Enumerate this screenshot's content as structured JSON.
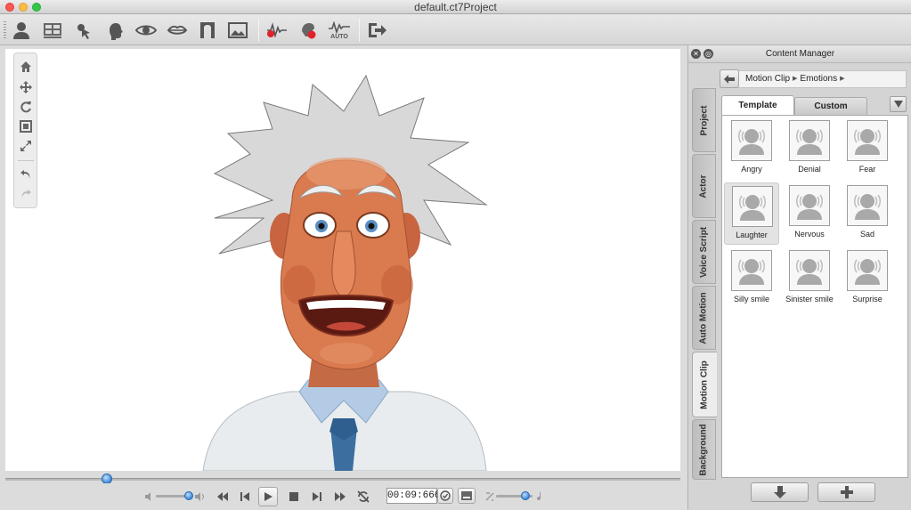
{
  "window": {
    "title": "default.ct7Project"
  },
  "toolbar": {
    "buttons": [
      {
        "name": "actor-icon"
      },
      {
        "name": "layout-icon"
      },
      {
        "name": "pointer-icon"
      },
      {
        "name": "head-icon"
      },
      {
        "name": "eye-icon"
      },
      {
        "name": "lips-icon"
      },
      {
        "name": "face-frame-icon"
      },
      {
        "name": "image-icon"
      },
      {
        "name": "voice-record-icon"
      },
      {
        "name": "face-record-icon"
      },
      {
        "name": "auto-motion-icon",
        "label": "AUTO"
      },
      {
        "name": "export-icon"
      }
    ]
  },
  "viewport": {
    "nav_tools": [
      "home-icon",
      "move-icon",
      "rotate-icon",
      "fit-icon",
      "zoom-icon",
      "undo-icon",
      "redo-icon"
    ]
  },
  "timeline": {
    "position_fraction": 0.15
  },
  "playback": {
    "time": "00:09:666",
    "volume_fraction": 0.9,
    "speed_fraction": 0.8
  },
  "content_manager": {
    "title": "Content Manager",
    "breadcrumb": [
      "Motion Clip",
      "Emotions"
    ],
    "side_tabs": [
      "Project",
      "Actor",
      "Voice Script",
      "Auto Motion",
      "Motion Clip",
      "Background"
    ],
    "active_side_tab": "Motion Clip",
    "tabs": [
      "Template",
      "Custom"
    ],
    "active_tab": "Template",
    "items": [
      "Angry",
      "Denial",
      "Fear",
      "Laughter",
      "Nervous",
      "Sad",
      "Silly smile",
      "Sinister smile",
      "Surprise"
    ],
    "selected_item": "Laughter"
  },
  "colors": {
    "record_red": "#e0222a",
    "slider_blue": "#3d86d8"
  }
}
